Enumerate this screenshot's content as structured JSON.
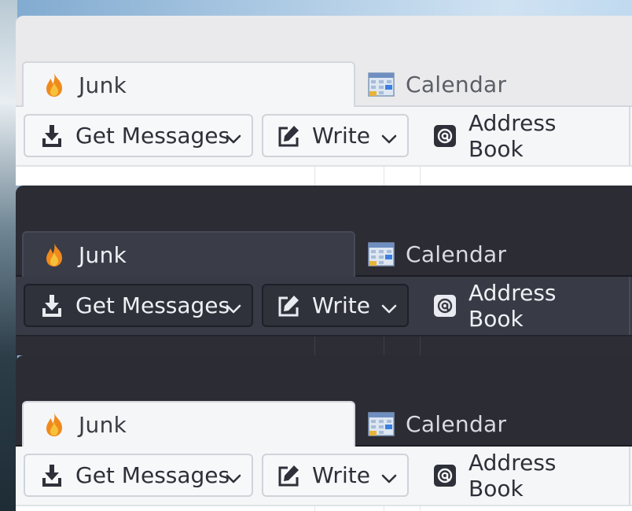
{
  "variants": [
    {
      "theme": "light",
      "tabs": [
        {
          "label": "Junk",
          "icon": "flame-icon"
        },
        {
          "label": "Calendar",
          "icon": "calendar-icon"
        }
      ],
      "toolbar": {
        "get_messages": "Get Messages",
        "write": "Write",
        "address_book": "Address Book"
      }
    },
    {
      "theme": "dark",
      "tabs": [
        {
          "label": "Junk",
          "icon": "flame-icon"
        },
        {
          "label": "Calendar",
          "icon": "calendar-icon"
        }
      ],
      "toolbar": {
        "get_messages": "Get Messages",
        "write": "Write",
        "address_book": "Address Book"
      }
    },
    {
      "theme": "dark-chrome-light-content",
      "tabs": [
        {
          "label": "Junk",
          "icon": "flame-icon"
        },
        {
          "label": "Calendar",
          "icon": "calendar-icon"
        }
      ],
      "toolbar": {
        "get_messages": "Get Messages",
        "write": "Write",
        "address_book": "Address Book"
      }
    }
  ],
  "colors": {
    "light_toolbar": "#f5f6f8",
    "dark_chrome": "#2b2c34",
    "dark_toolbar": "#383a45",
    "flame": "#f08a1c"
  }
}
